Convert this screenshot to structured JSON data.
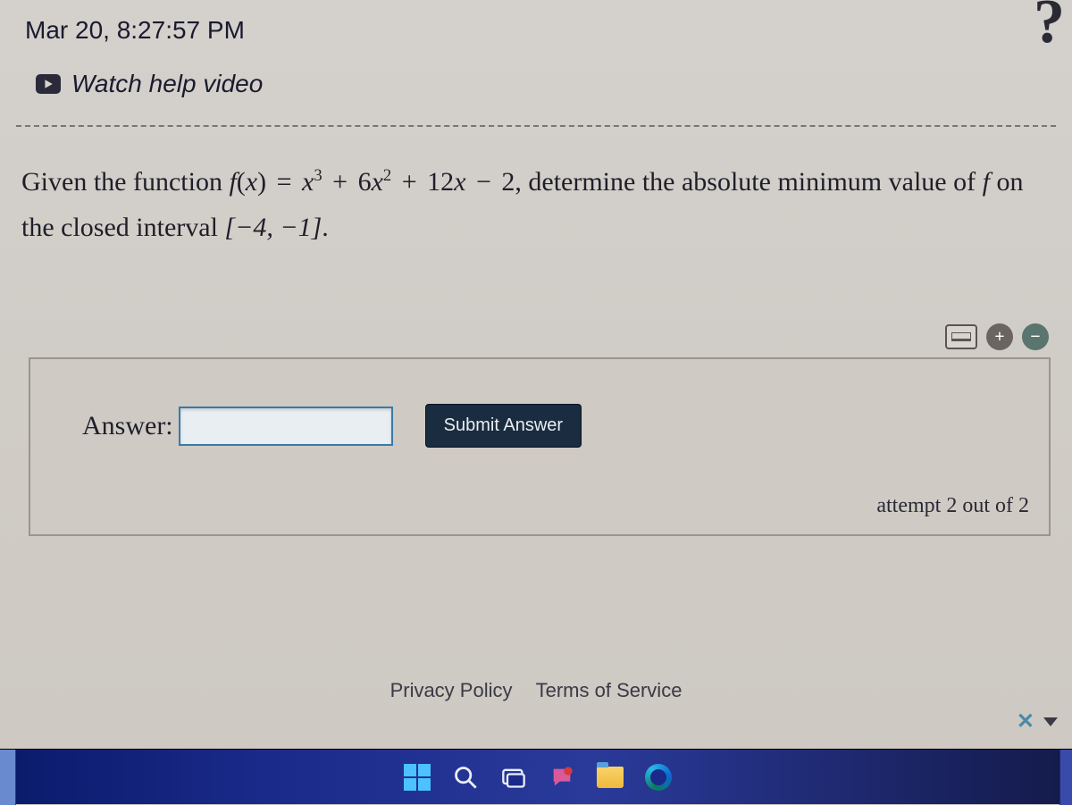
{
  "header": {
    "timestamp": "Mar 20, 8:27:57 PM",
    "watch_help_label": "Watch help video",
    "help_icon_label": "?"
  },
  "question": {
    "lead_in": "Given the function ",
    "func_lhs": "f(x) = ",
    "poly_term1_var": "x",
    "poly_term1_exp": "3",
    "poly_op1": " + ",
    "poly_term2_coef": "6",
    "poly_term2_var": "x",
    "poly_term2_exp": "2",
    "poly_op2": " + ",
    "poly_term3_coef": "12",
    "poly_term3_var": "x",
    "poly_op3": " − ",
    "poly_term4": "2",
    "mid_text": ", determine the absolute minimum value of ",
    "func_letter": "f",
    "tail_text_1": " on the closed interval ",
    "interval": "[−4, −1]",
    "period": "."
  },
  "answer_panel": {
    "label": "Answer:",
    "input_value": "",
    "submit_label": "Submit Answer",
    "attempt_text": "attempt 2 out of 2",
    "tools": {
      "keyboard": "keyboard",
      "zoom_in": "+",
      "zoom_out": "−"
    }
  },
  "footer": {
    "privacy": "Privacy Policy",
    "terms": "Terms of Service"
  },
  "corner": {
    "close": "✕"
  },
  "taskbar": {
    "start": "Start",
    "search": "Search",
    "task_view": "Task View",
    "chat": "Chat",
    "explorer": "File Explorer",
    "edge": "Microsoft Edge"
  }
}
